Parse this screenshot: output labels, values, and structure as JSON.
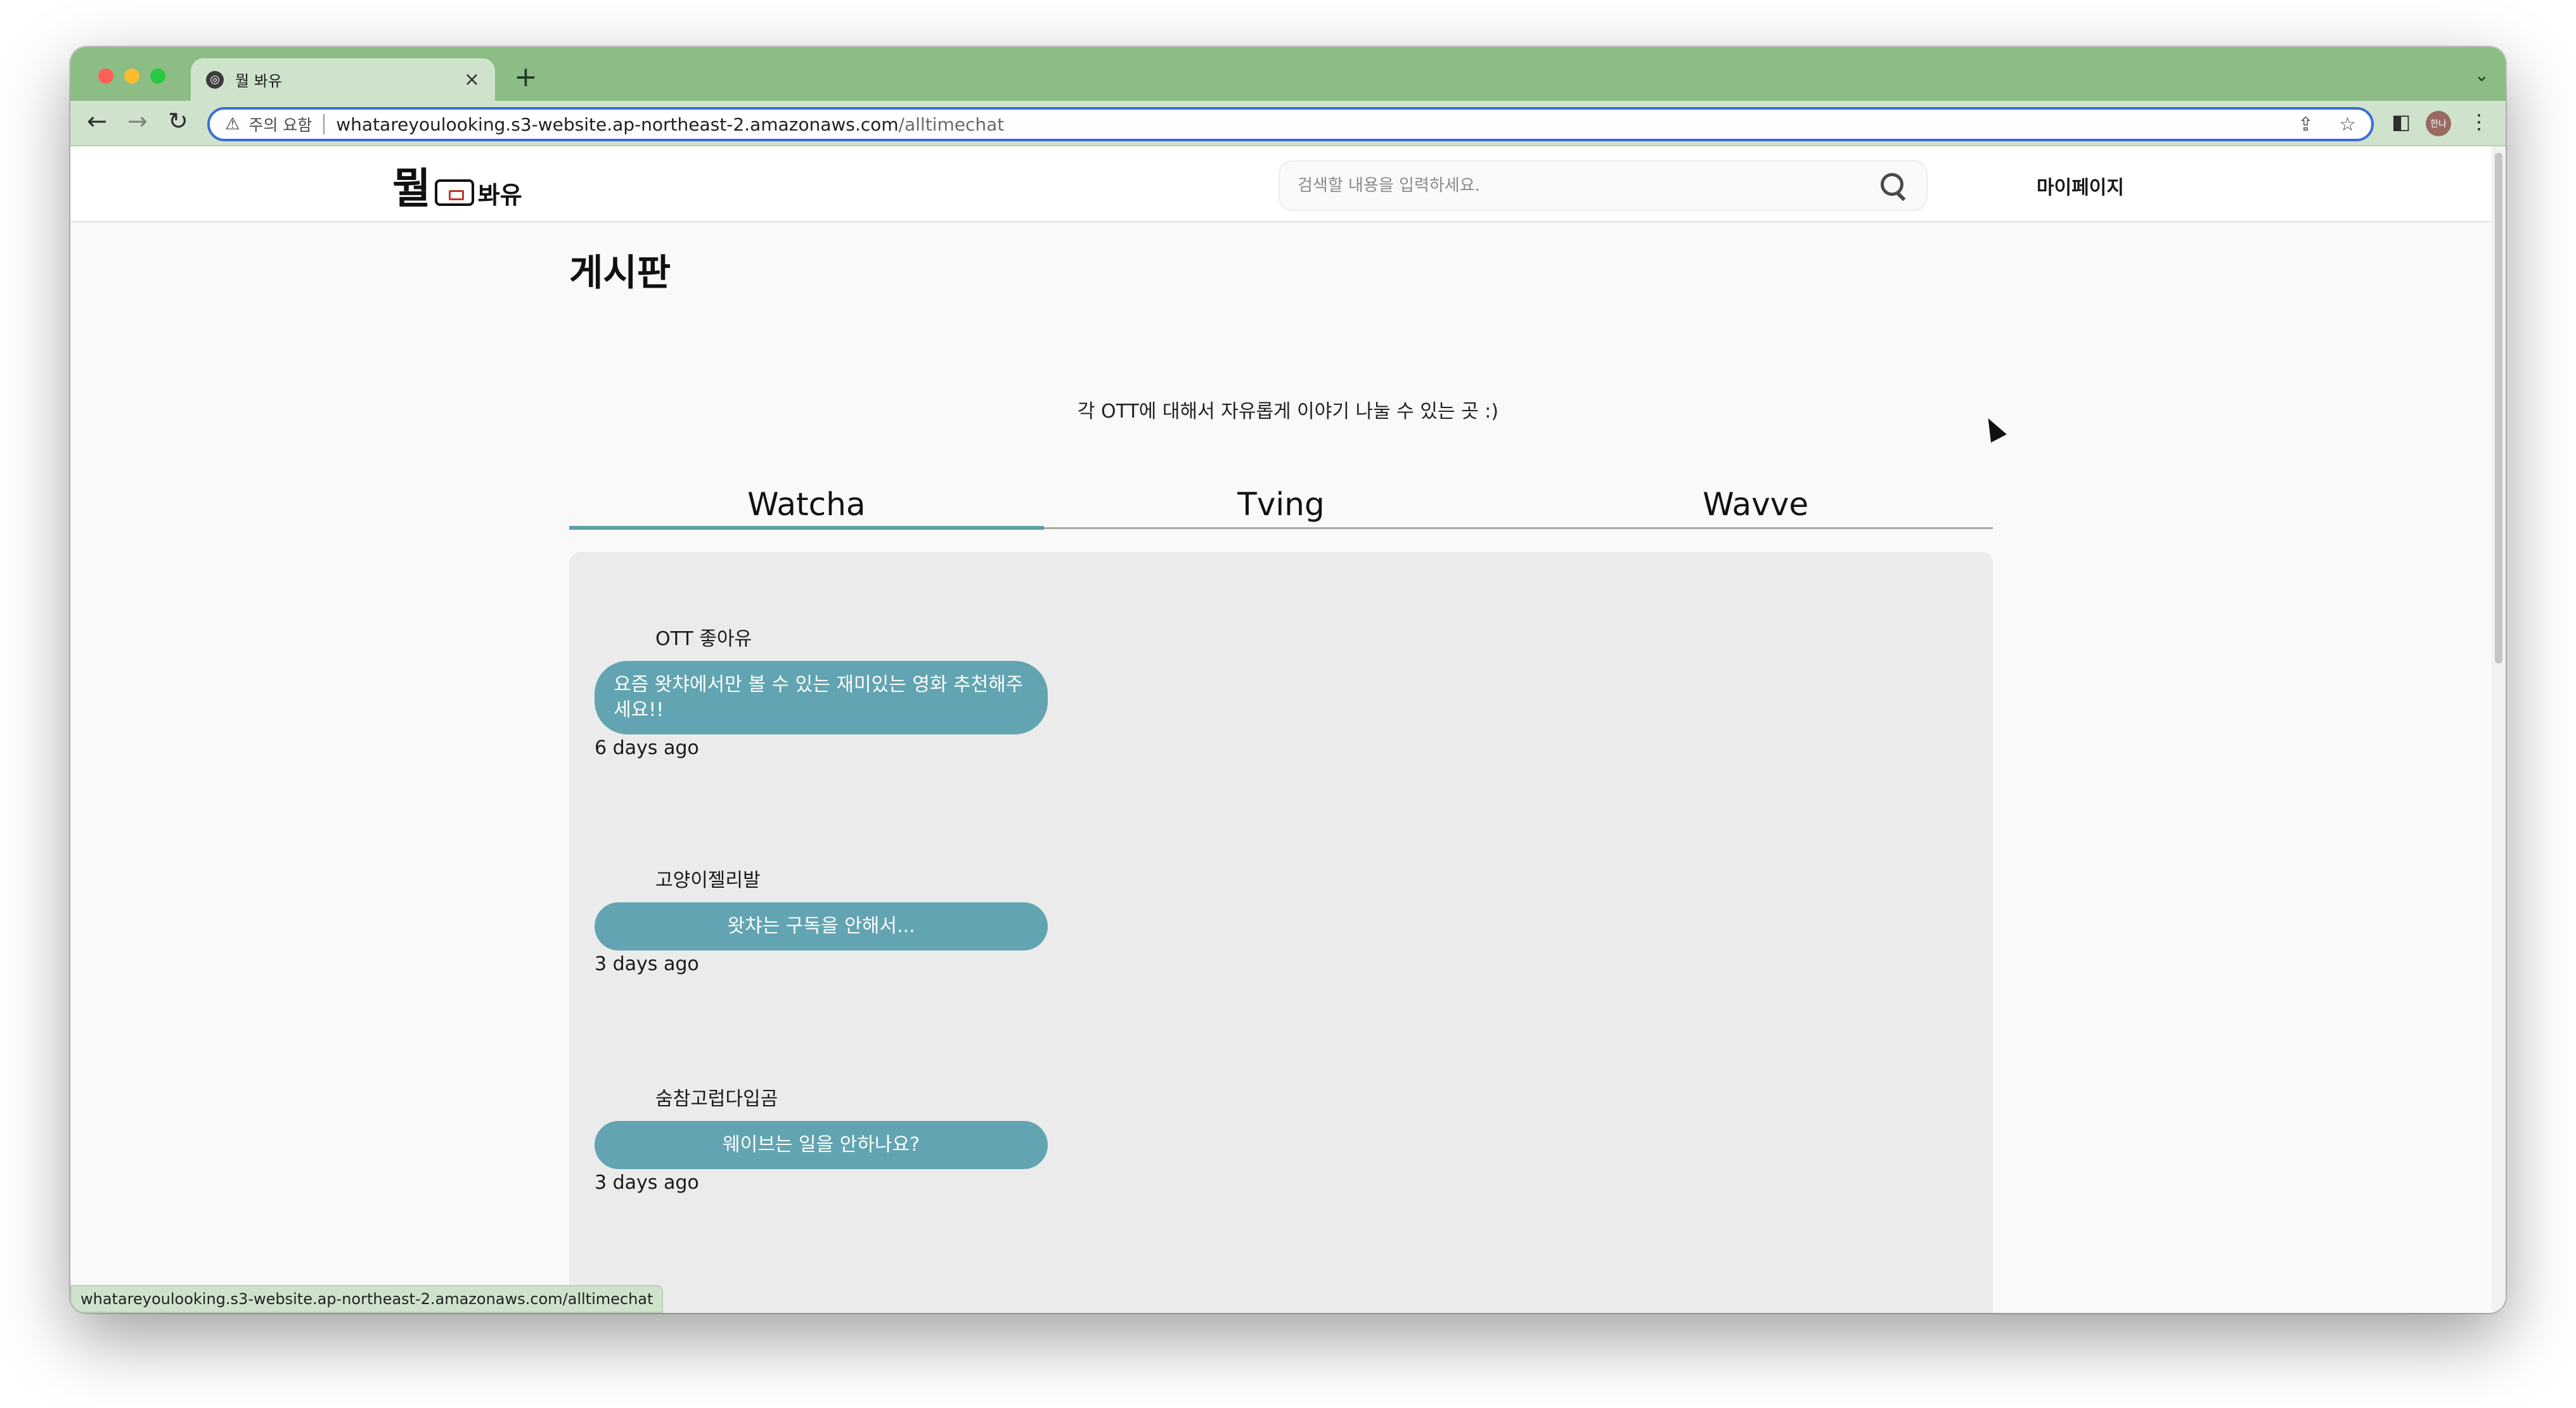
{
  "browser": {
    "tab_title": "뭘 봐유",
    "new_tab": "+",
    "tab_close": "×",
    "security_label": "주의 요함",
    "url_host": "whatareyoulooking.s3-website.ap-northeast-2.amazonaws.com",
    "url_path": "/alltimechat",
    "status_url": "whatareyoulooking.s3-website.ap-northeast-2.amazonaws.com/alltimechat",
    "avatar_text": "한나",
    "accent_color": "#8bbd84"
  },
  "site": {
    "logo_main": "뭘",
    "logo_sub": "봐유",
    "search_placeholder": "검색할 내용을 입력하세요.",
    "mypage_label": "마이페이지"
  },
  "board": {
    "title": "게시판",
    "description": "각 OTT에 대해서 자유롭게 이야기 나눌 수 있는 곳 :)",
    "tabs": [
      {
        "label": "Watcha",
        "active": true
      },
      {
        "label": "Tving",
        "active": false
      },
      {
        "label": "Wavve",
        "active": false
      }
    ],
    "bubble_color": "#62a4b1",
    "posts": [
      {
        "author": "OTT 좋아유",
        "message": "요즘 왓챠에서만 볼 수 있는 재미있는 영화 추천해주세요!!",
        "time": "6 days ago"
      },
      {
        "author": "고양이젤리발",
        "message": "왓챠는 구독을 안해서...",
        "time": "3 days ago"
      },
      {
        "author": "숨참고럽다입곰",
        "message": "웨이브는 일을 안하나요?",
        "time": "3 days ago"
      }
    ]
  }
}
